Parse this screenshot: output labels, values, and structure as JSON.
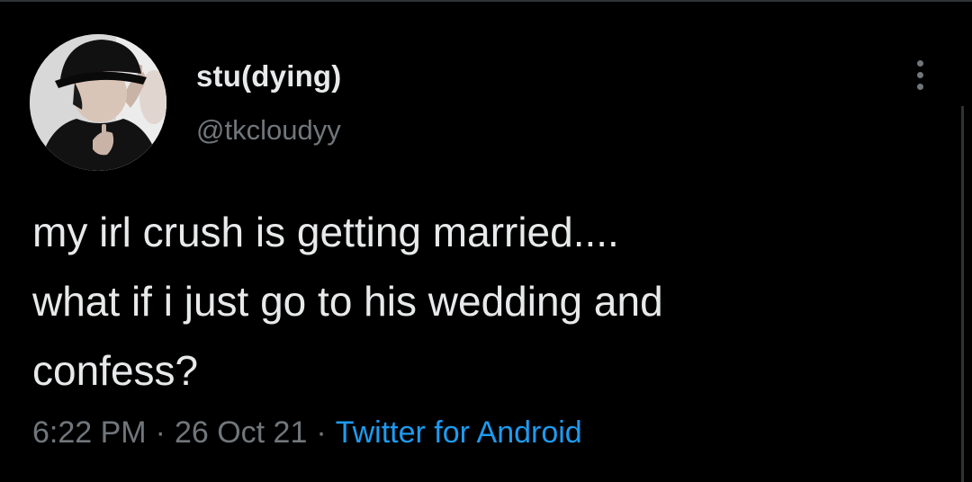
{
  "tweet": {
    "author": {
      "display_name": "stu(dying)",
      "handle": "@tkcloudyy",
      "avatar_icon": "profile-photo"
    },
    "text_lines": [
      "my irl crush is getting married....",
      "what if i just go to his wedding and",
      "confess?"
    ],
    "meta": {
      "time": "6:22 PM",
      "separator": "·",
      "date": "26 Oct 21",
      "source": "Twitter for Android"
    },
    "more_icon": "more-options-icon"
  },
  "colors": {
    "background": "#000000",
    "primary_text": "#e7e9ea",
    "secondary_text": "#71767b",
    "link": "#1d9bf0",
    "divider": "#2f3336"
  }
}
